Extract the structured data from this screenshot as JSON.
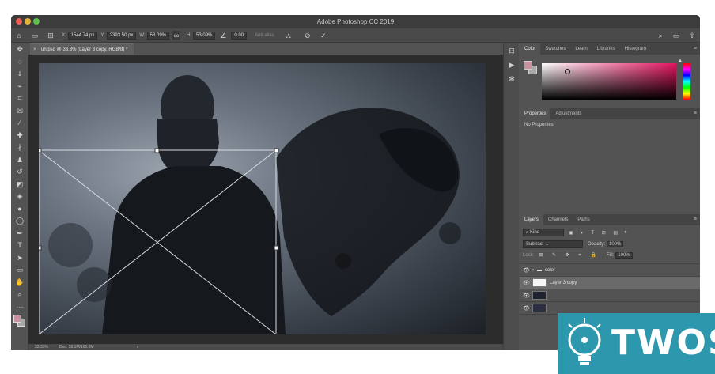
{
  "window": {
    "title": "Adobe Photoshop CC 2019"
  },
  "options_bar": {
    "x_label": "X:",
    "x_value": "1544.74 px",
    "y_label": "Y:",
    "y_value": "2393.50 px",
    "w_label": "W:",
    "w_value": "53.09%",
    "h_label": "H:",
    "h_value": "53.09%",
    "angle_value": "0.00",
    "antialias_label": "Anti-alias"
  },
  "document": {
    "tab_label": "un.psd @ 33.3% (Layer 3 copy, RGB/8) *",
    "zoom": "33.33%",
    "doc_info": "Doc: 58.1M/165.9M"
  },
  "color_panel": {
    "tabs": [
      "Color",
      "Swatches",
      "Learn",
      "Libraries",
      "Histogram"
    ],
    "foreground_color": "#c9909f",
    "background_color": "#a9a9a9"
  },
  "properties_panel": {
    "tabs": [
      "Properties",
      "Adjustments"
    ],
    "message": "No Properties"
  },
  "layers_panel": {
    "tabs": [
      "Layers",
      "Channels",
      "Paths"
    ],
    "filter_placeholder": "Kind",
    "blend_mode": "Subtract",
    "opacity_label": "Opacity:",
    "opacity_value": "100%",
    "lock_label": "Lock:",
    "fill_label": "Fill:",
    "fill_value": "100%",
    "layers": [
      {
        "name": "color",
        "type": "group"
      },
      {
        "name": "Layer 3 copy",
        "type": "layer"
      },
      {
        "name": "",
        "type": "layer"
      },
      {
        "name": "",
        "type": "layer"
      }
    ]
  },
  "watermark": {
    "text": "TWOS"
  }
}
